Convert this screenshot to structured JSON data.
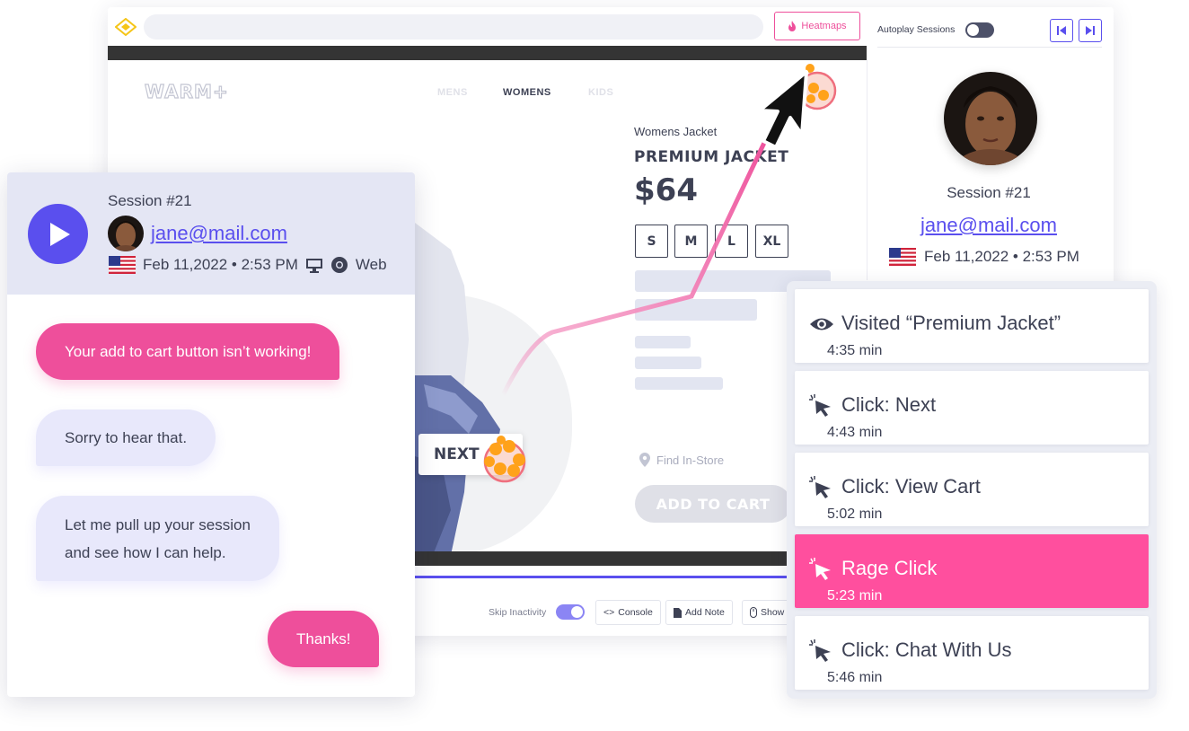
{
  "topbar": {
    "heatmaps_label": "Heatmaps",
    "autoplay_label": "Autoplay Sessions"
  },
  "profile": {
    "session": "Session #21",
    "email": "jane@mail.com",
    "date": "Feb 11,2022 • 2:53 PM"
  },
  "shop": {
    "logo": "WARM+",
    "nav": [
      "MENS",
      "WOMENS",
      "KIDS"
    ],
    "category": "Womens Jacket",
    "product_name": "PREMIUM JACKET",
    "price": "$64",
    "sizes": [
      "S",
      "M",
      "L",
      "XL"
    ],
    "find_store": "Find In-Store",
    "add_to_cart": "ADD TO CART",
    "next_label": "NEXT"
  },
  "controls": {
    "skip_inactivity": "Skip Inactivity",
    "console": "Console",
    "add_note": "Add Note",
    "show": "Show"
  },
  "chat": {
    "session": "Session #21",
    "email": "jane@mail.com",
    "date": "Feb 11,2022 • 2:53 PM",
    "platform": "Web",
    "messages": [
      {
        "text": "Your add to cart button isn’t working!",
        "from": "user"
      },
      {
        "text": "Sorry to hear that.",
        "from": "agent"
      },
      {
        "text": "Let me pull up your session",
        "text2": "and see how I can help.",
        "from": "agent"
      },
      {
        "text": "Thanks!",
        "from": "user"
      }
    ]
  },
  "events": [
    {
      "title": "Visited “Premium Jacket”",
      "time": "4:35 min",
      "icon": "eye-icon"
    },
    {
      "title": "Click: Next",
      "time": "4:43 min",
      "icon": "cursor-click-icon"
    },
    {
      "title": "Click: View Cart",
      "time": "5:02 min",
      "icon": "cursor-click-icon"
    },
    {
      "title": "Rage Click",
      "time": "5:23 min",
      "icon": "cursor-click-icon",
      "active": true
    },
    {
      "title": "Click: Chat With Us",
      "time": "5:46 min",
      "icon": "cursor-click-icon"
    }
  ],
  "colors": {
    "accent": "#5a4fee",
    "pink": "#ee4f9b",
    "text": "#3d4154"
  }
}
